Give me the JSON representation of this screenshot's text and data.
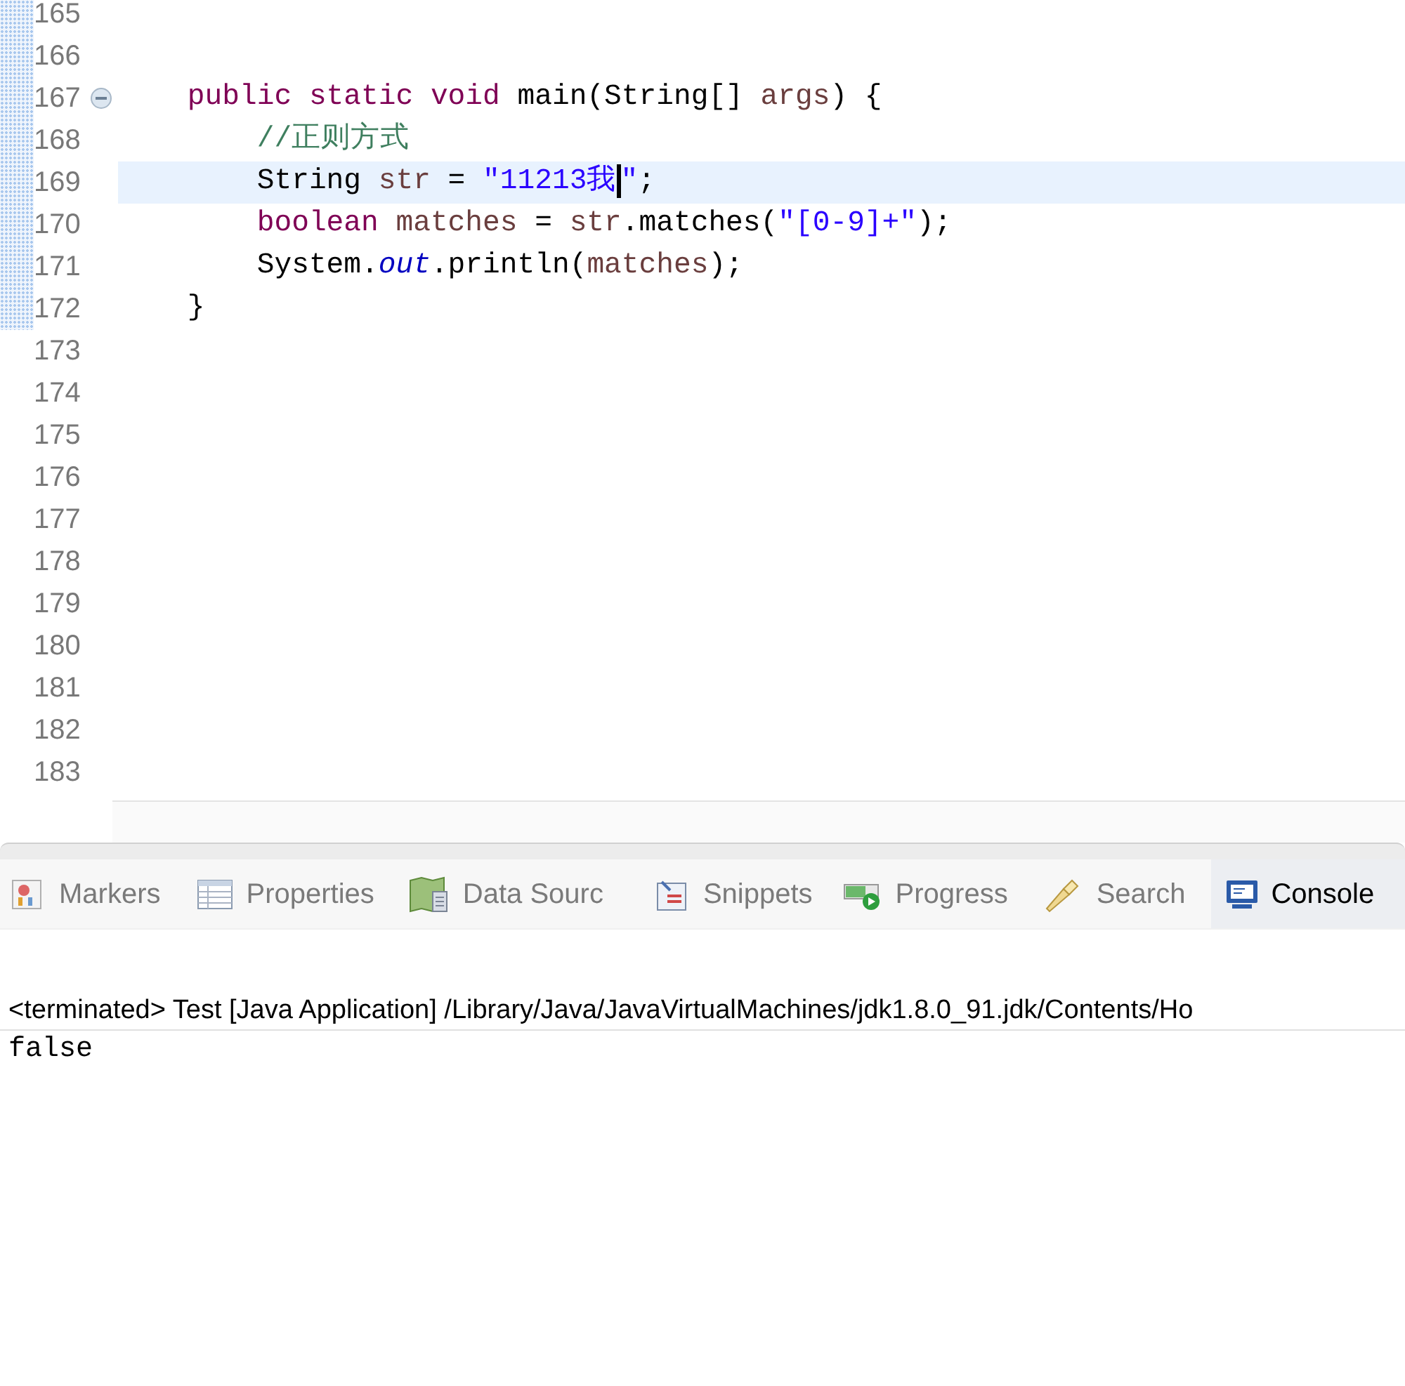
{
  "editor": {
    "lines": [
      {
        "number": "165",
        "current": false,
        "fold_marker": false
      },
      {
        "number": "166",
        "current": false,
        "fold_marker": false
      },
      {
        "number": "167",
        "current": false,
        "fold_marker": true,
        "tokens": [
          {
            "kind": "keyword",
            "text": "    public static void"
          },
          {
            "kind": "plain",
            "text": " main(String[] "
          },
          {
            "kind": "variable",
            "text": "args"
          },
          {
            "kind": "plain",
            "text": ") {"
          }
        ]
      },
      {
        "number": "168",
        "current": false,
        "fold_marker": false,
        "tokens": [
          {
            "kind": "comment",
            "text": "        //正则方式"
          }
        ]
      },
      {
        "number": "169",
        "current": true,
        "fold_marker": false,
        "tokens": [
          {
            "kind": "plain",
            "text": "        String "
          },
          {
            "kind": "variable",
            "text": "str"
          },
          {
            "kind": "plain",
            "text": " = "
          },
          {
            "kind": "string",
            "text": "\"11213我"
          },
          {
            "kind": "caret"
          },
          {
            "kind": "string",
            "text": "\""
          },
          {
            "kind": "plain",
            "text": ";"
          }
        ]
      },
      {
        "number": "170",
        "current": false,
        "fold_marker": false,
        "tokens": [
          {
            "kind": "keyword",
            "text": "        boolean "
          },
          {
            "kind": "variable",
            "text": "matches"
          },
          {
            "kind": "plain",
            "text": " = "
          },
          {
            "kind": "variable",
            "text": "str"
          },
          {
            "kind": "plain",
            "text": ".matches("
          },
          {
            "kind": "string",
            "text": "\"[0-9]+\""
          },
          {
            "kind": "plain",
            "text": ");"
          }
        ]
      },
      {
        "number": "171",
        "current": false,
        "fold_marker": false,
        "tokens": [
          {
            "kind": "plain",
            "text": "        System."
          },
          {
            "kind": "static_field",
            "text": "out"
          },
          {
            "kind": "plain",
            "text": ".println("
          },
          {
            "kind": "variable",
            "text": "matches"
          },
          {
            "kind": "plain",
            "text": ");"
          }
        ]
      },
      {
        "number": "172",
        "current": false,
        "fold_marker": false,
        "tokens": [
          {
            "kind": "plain",
            "text": "    }"
          }
        ]
      },
      {
        "number": "173",
        "current": false,
        "fold_marker": false
      },
      {
        "number": "174",
        "current": false,
        "fold_marker": false
      },
      {
        "number": "175",
        "current": false,
        "fold_marker": false
      },
      {
        "number": "176",
        "current": false,
        "fold_marker": false
      },
      {
        "number": "177",
        "current": false,
        "fold_marker": false
      },
      {
        "number": "178",
        "current": false,
        "fold_marker": false
      },
      {
        "number": "179",
        "current": false,
        "fold_marker": false
      },
      {
        "number": "180",
        "current": false,
        "fold_marker": false
      },
      {
        "number": "181",
        "current": false,
        "fold_marker": false
      },
      {
        "number": "182",
        "current": false,
        "fold_marker": false
      },
      {
        "number": "183",
        "current": false,
        "fold_marker": false
      }
    ]
  },
  "views": {
    "tabs": [
      {
        "label": "Markers",
        "selected": false
      },
      {
        "label": "Properties",
        "selected": false
      },
      {
        "label": "Data Sourc",
        "selected": false
      },
      {
        "label": "Snippets",
        "selected": false
      },
      {
        "label": "Progress",
        "selected": false
      },
      {
        "label": "Search",
        "selected": false
      },
      {
        "label": "Console",
        "selected": true
      }
    ]
  },
  "console": {
    "header": "<terminated> Test [Java Application] /Library/Java/JavaVirtualMachines/jdk1.8.0_91.jdk/Contents/Ho",
    "output": "false"
  }
}
